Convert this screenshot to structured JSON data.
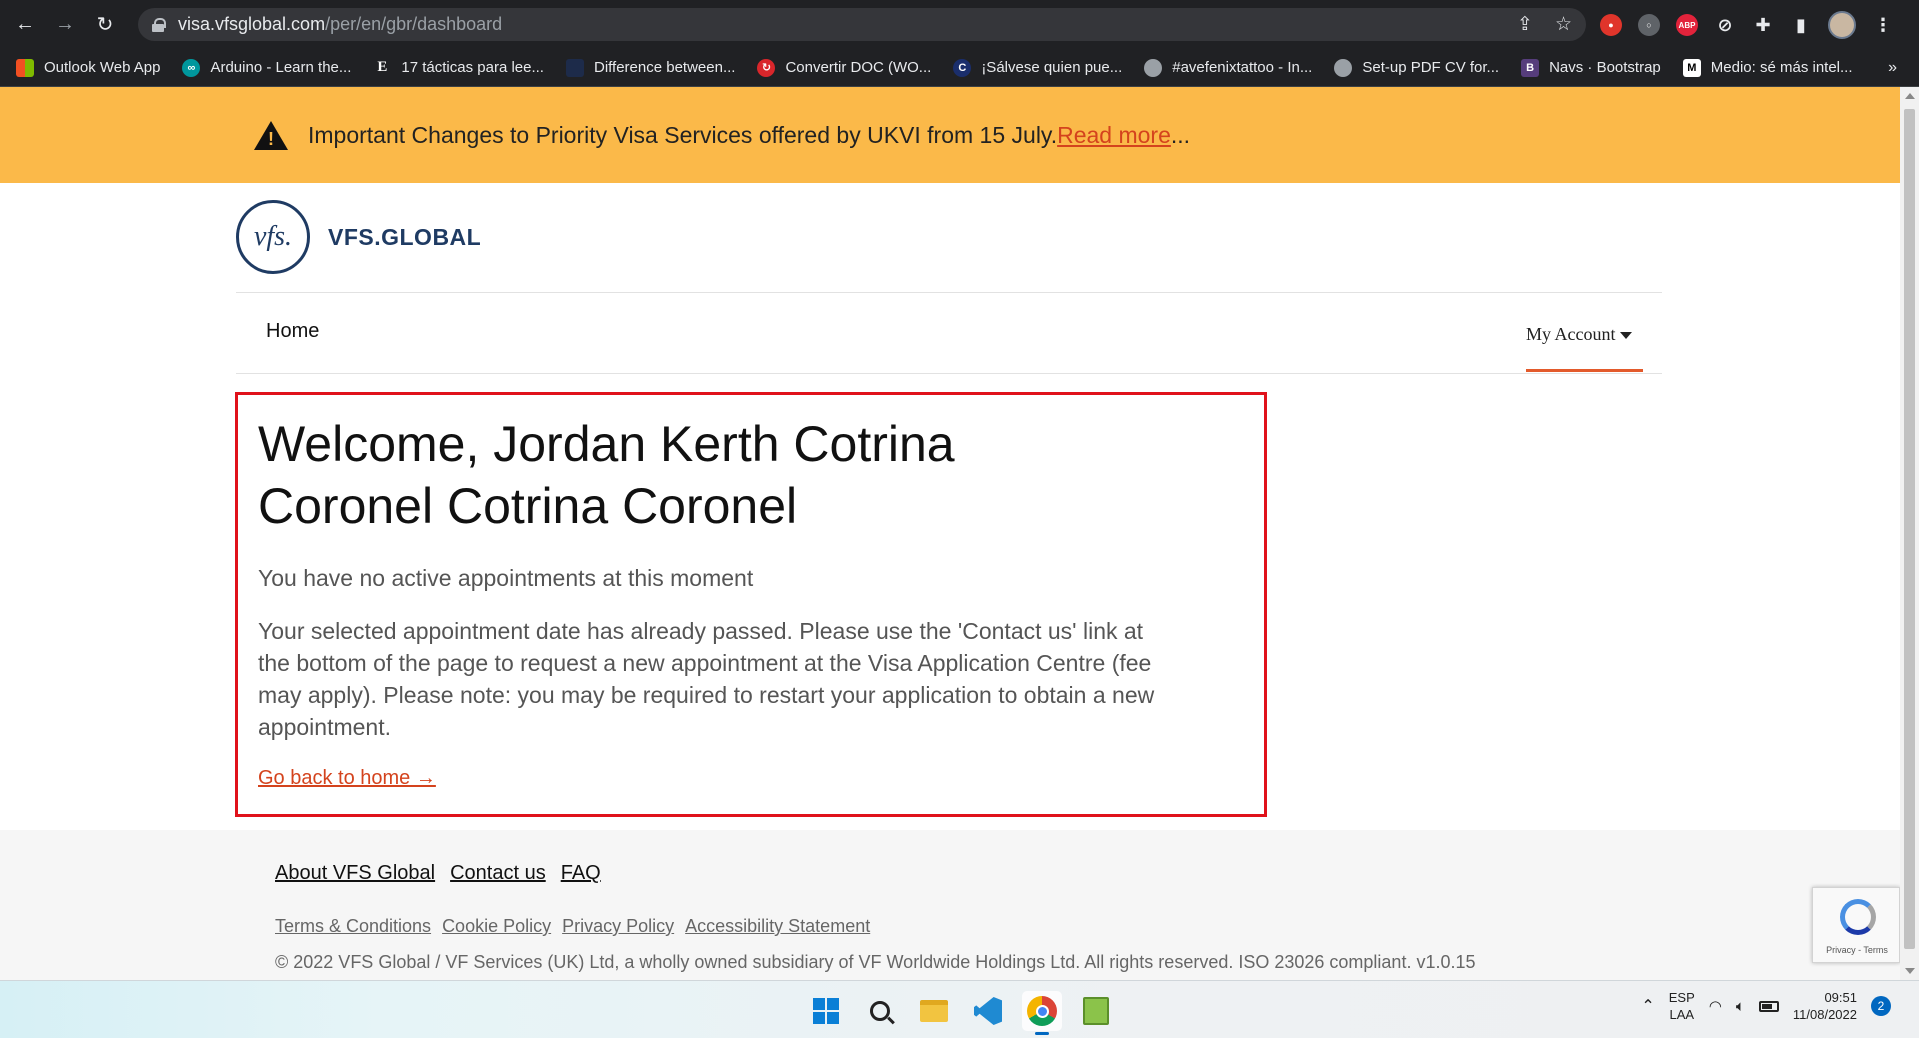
{
  "browser": {
    "url_host": "visa.vfsglobal.com",
    "url_path": "/per/en/gbr/dashboard",
    "bookmarks": [
      {
        "label": "Outlook Web App",
        "icon": "ms-icon"
      },
      {
        "label": "Arduino - Learn the...",
        "icon": "arduino-icon"
      },
      {
        "label": "17 tácticas para lee...",
        "icon": "e-icon"
      },
      {
        "label": "Difference between...",
        "icon": "site-icon"
      },
      {
        "label": "Convertir DOC (WO...",
        "icon": "convert-icon"
      },
      {
        "label": "¡Sálvese quien pue...",
        "icon": "c-icon"
      },
      {
        "label": "#avefenixtattoo - In...",
        "icon": "globe-icon"
      },
      {
        "label": "Set-up PDF CV for...",
        "icon": "globe-icon"
      },
      {
        "label": "Navs · Bootstrap",
        "icon": "bootstrap-icon"
      },
      {
        "label": "Medio: sé más intel...",
        "icon": "medium-icon"
      }
    ],
    "more": "»"
  },
  "alert": {
    "text": "Important Changes to Priority Visa Services offered by UKVI from 15 July. ",
    "link": "Read more",
    "suffix": "..."
  },
  "logo": {
    "mark": "vfs.",
    "name": "VFS.GLOBAL"
  },
  "nav": {
    "home": "Home",
    "account": "My Account"
  },
  "welcome": {
    "title": "Welcome, Jordan Kerth Cotrina Coronel Cotrina Coronel",
    "no_appointments": "You have no active appointments at this moment",
    "passed_message": "Your selected appointment date has already passed. Please use the 'Contact us' link at the bottom of the page to request a new appointment at the Visa Application Centre (fee may apply). Please note: you may be required to restart your application to obtain a new appointment.",
    "back_home": "Go back to home →"
  },
  "footer": {
    "primary_links": [
      "About VFS Global",
      "Contact us",
      "FAQ"
    ],
    "secondary_links": [
      "Terms & Conditions",
      "Cookie Policy",
      "Privacy Policy",
      "Accessibility Statement"
    ],
    "copyright": "© 2022 VFS Global / VF Services (UK) Ltd, a wholly owned subsidiary of VF Worldwide Holdings Ltd. All rights reserved. ISO 23026 compliant. v1.0.15"
  },
  "recaptcha": {
    "text": "Privacy - Terms"
  },
  "taskbar": {
    "lang_top": "ESP",
    "lang_bottom": "LAA",
    "time": "09:51",
    "date": "11/08/2022",
    "notifications": "2"
  },
  "colors": {
    "alert_bg": "#fbb949",
    "accent": "#d4431d",
    "brand": "#1f3b63",
    "highlight_border": "#e0121b"
  }
}
